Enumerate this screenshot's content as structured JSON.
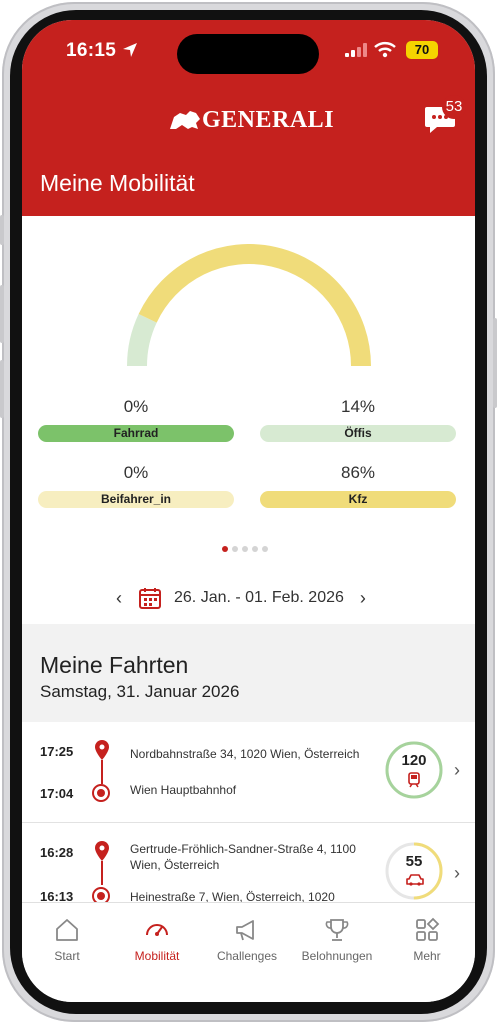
{
  "status": {
    "time": "16:15",
    "battery": "70",
    "icons": [
      "location-arrow-icon",
      "cellular-signal-icon",
      "wifi-icon",
      "battery-icon"
    ]
  },
  "header": {
    "brand": "GENERALI",
    "chat_badge": "53",
    "title": "Meine Mobilität"
  },
  "mobility": {
    "shares": {
      "fahrrad": 0,
      "oeffis": 14,
      "beifahrer": 0,
      "kfz": 86
    },
    "labels": {
      "fahrrad": "Fahrrad",
      "oeffis": "Öffis",
      "beifahrer": "Beifahrer_in",
      "kfz": "Kfz"
    },
    "values": {
      "fahrrad": "0%",
      "oeffis": "14%",
      "beifahrer": "0%",
      "kfz": "86%"
    },
    "colors": {
      "fahrrad": "#7cc26a",
      "oeffis": "#d7ead2",
      "beifahrer": "#f7eec0",
      "kfz": "#f0dc7a"
    },
    "page_count": 5,
    "page_active": 1
  },
  "date_range": "26. Jan. - 01. Feb. 2026",
  "trips_section": {
    "title": "Meine Fahrten",
    "date": "Samstag, 31. Januar 2026"
  },
  "trips": [
    {
      "start_time": "17:25",
      "start": "Nordbahnstraße 34, 1020 Wien, Österreich",
      "end_time": "17:04",
      "end": "Wien Hauptbahnhof",
      "score": "120",
      "mode": "train-icon",
      "ring_color": "#a6d39c",
      "ring_fraction": 1.0
    },
    {
      "start_time": "16:28",
      "start": "Gertrude-Fröhlich-Sandner-Straße 4, 1100 Wien, Österreich",
      "end_time": "16:13",
      "end": "Heinestraße 7, Wien, Österreich, 1020",
      "score": "55",
      "mode": "car-icon",
      "ring_color": "#f0dc7a",
      "ring_fraction": 0.5
    }
  ],
  "tabs": [
    {
      "label": "Start",
      "icon": "home-icon"
    },
    {
      "label": "Mobilität",
      "icon": "speedometer-icon",
      "active": true
    },
    {
      "label": "Challenges",
      "icon": "megaphone-icon"
    },
    {
      "label": "Belohnungen",
      "icon": "trophy-icon"
    },
    {
      "label": "Mehr",
      "icon": "grid-icon"
    }
  ],
  "brand_color": "#c5211e"
}
